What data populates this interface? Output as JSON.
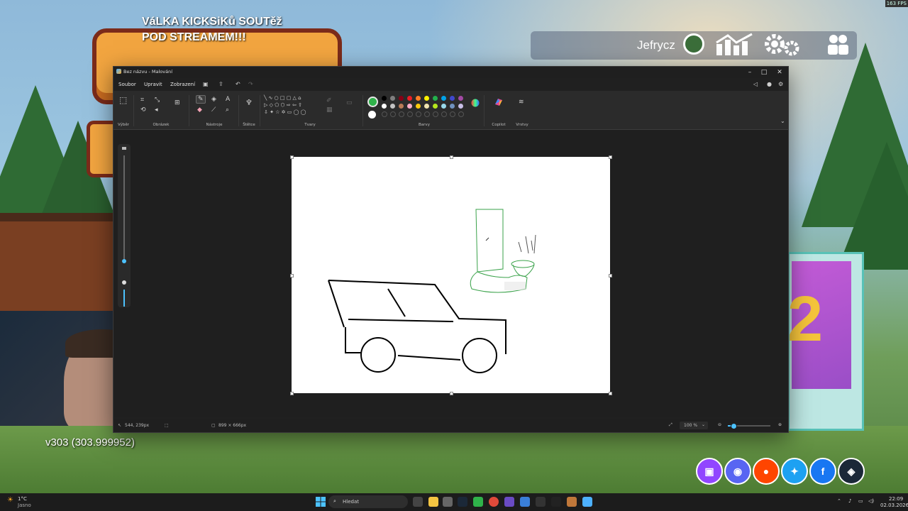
{
  "overlay": {
    "contest_line1": "VáLKA KICKSiKů SOUTěž",
    "contest_line2": "POD STREAMEM!!!",
    "player_name": "Jefrycz",
    "fps": "163 FPS",
    "version": "v303 (303.999952)",
    "hud_icons": [
      "stats-icon",
      "settings-icon",
      "party-icon"
    ],
    "socials": [
      "twitch",
      "discord",
      "reddit",
      "twitter",
      "facebook",
      "steam"
    ],
    "social_colors": {
      "twitch": "#9146ff",
      "discord": "#5865f2",
      "reddit": "#ff4500",
      "twitter": "#1da1f2",
      "facebook": "#1877f2",
      "steam": "#1b2838"
    }
  },
  "paint": {
    "title": "Bez názvu - Malování",
    "menu": [
      "Soubor",
      "Upravit",
      "Zobrazení"
    ],
    "ribbon_groups": {
      "select": "Výběr",
      "image": "Obrázek",
      "tools": "Nástroje",
      "brushes": "Štětce",
      "shapes": "Tvary",
      "colors": "Barvy",
      "copilot": "Copilot",
      "layers": "Vrstvy"
    },
    "primary_color": "#2fb24a",
    "secondary_color": "#ffffff",
    "palette_row1": [
      "#000000",
      "#7f7f7f",
      "#880015",
      "#ed1c24",
      "#ff7f27",
      "#fff200",
      "#22b14c",
      "#00a2e8",
      "#3f48cc",
      "#a349a4"
    ],
    "palette_row2": [
      "#ffffff",
      "#c3c3c3",
      "#b97a57",
      "#ffaec9",
      "#ffc90e",
      "#efe4b0",
      "#b5e61d",
      "#99d9ea",
      "#7092be",
      "#c8bfe7"
    ],
    "status": {
      "cursor_pos": "544, 239px",
      "canvas_size": "899 × 666px",
      "zoom": "100 %"
    },
    "zoom_fraction": 0.12
  },
  "taskbar": {
    "weather_temp": "1°C",
    "weather_desc": "Jasno",
    "search_placeholder": "Hledat",
    "time": "22:09",
    "date": "02.03.2026"
  }
}
